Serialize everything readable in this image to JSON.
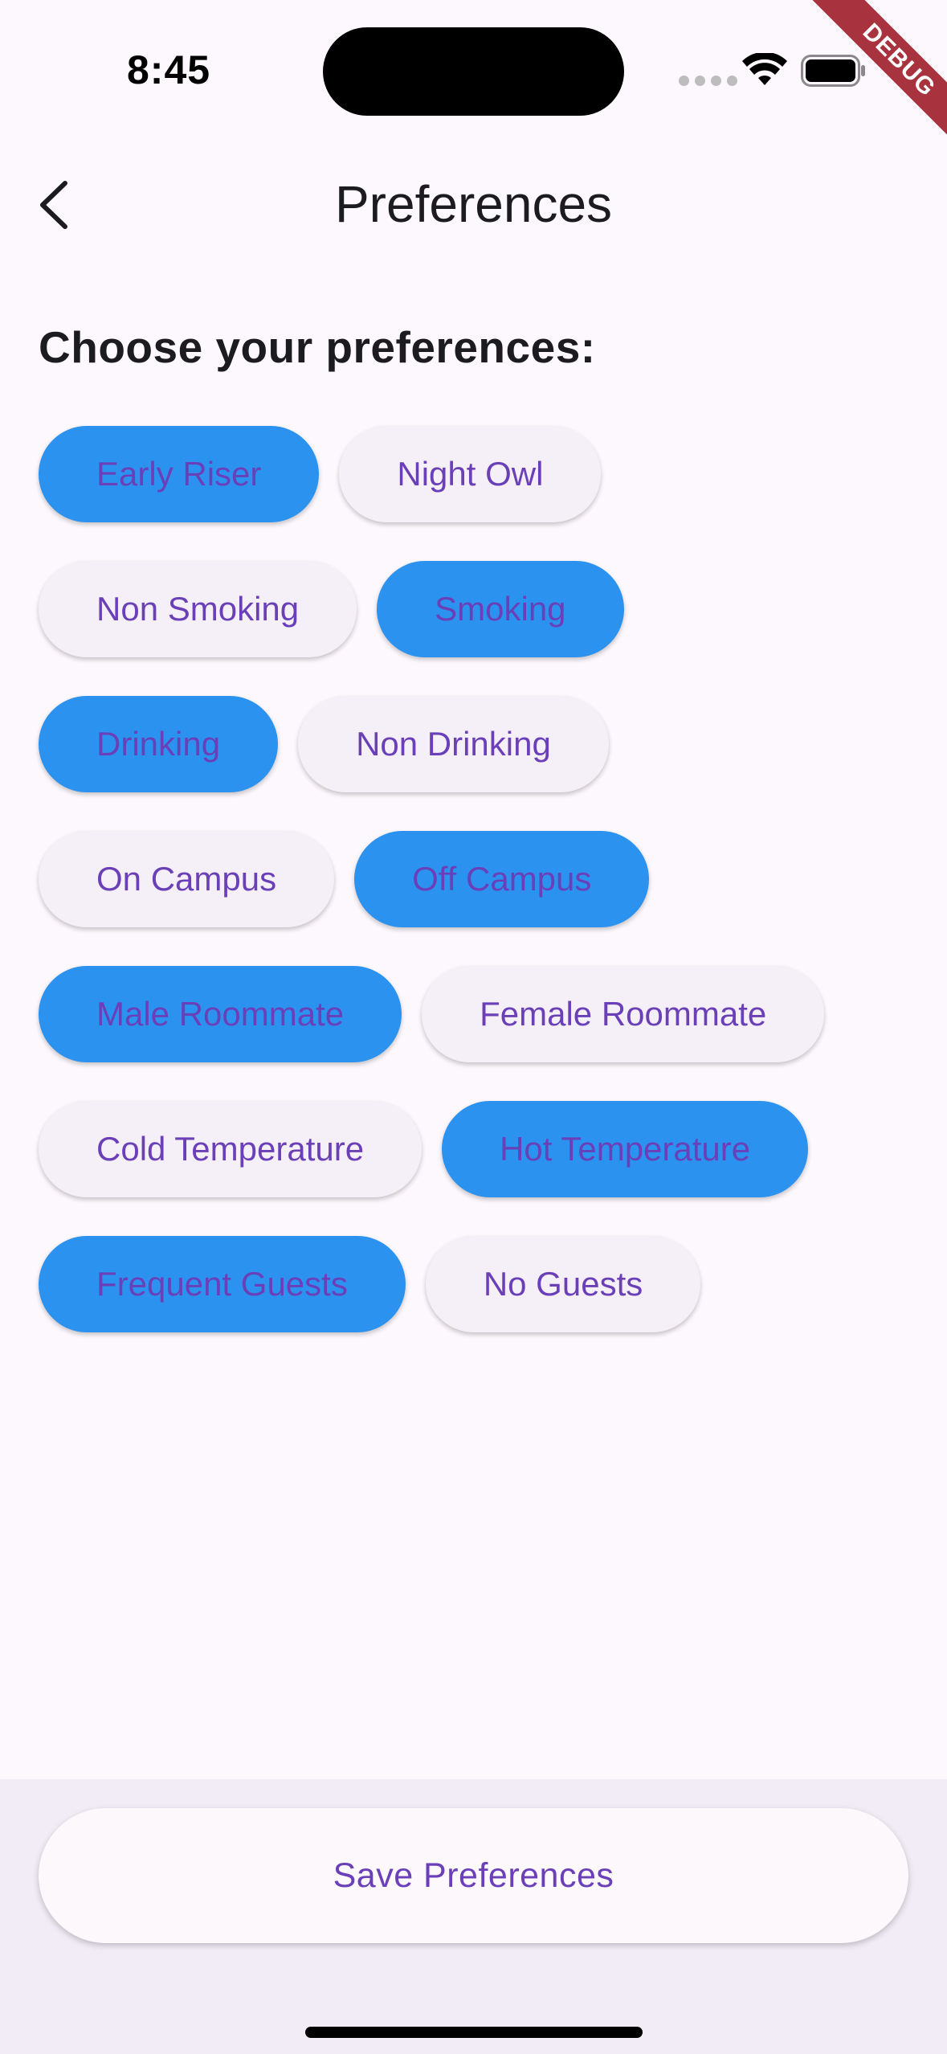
{
  "status_bar": {
    "time": "8:45",
    "debug_label": "DEBUG"
  },
  "app_bar": {
    "title": "Preferences",
    "back_icon": "chevron-left-icon"
  },
  "heading": "Choose your preferences:",
  "chip_rows": [
    [
      {
        "label": "Early Riser",
        "selected": true
      },
      {
        "label": "Night Owl",
        "selected": false
      }
    ],
    [
      {
        "label": "Non Smoking",
        "selected": false
      },
      {
        "label": "Smoking",
        "selected": true
      }
    ],
    [
      {
        "label": "Drinking",
        "selected": true
      },
      {
        "label": "Non Drinking",
        "selected": false
      }
    ],
    [
      {
        "label": "On Campus",
        "selected": false
      },
      {
        "label": "Off Campus",
        "selected": true
      }
    ],
    [
      {
        "label": "Male Roommate",
        "selected": true
      },
      {
        "label": "Female Roommate",
        "selected": false
      }
    ],
    [
      {
        "label": "Cold Temperature",
        "selected": false
      },
      {
        "label": "Hot Temperature",
        "selected": true
      }
    ],
    [
      {
        "label": "Frequent Guests",
        "selected": true
      },
      {
        "label": "No Guests",
        "selected": false
      }
    ]
  ],
  "save_button": {
    "label": "Save Preferences"
  },
  "colors": {
    "selected_chip": "#2b93ef",
    "unselected_chip": "#f5f0f7",
    "chip_text": "#6a3fb8",
    "background": "#fdf8fd",
    "bottom_bar": "#f2ecf7"
  }
}
